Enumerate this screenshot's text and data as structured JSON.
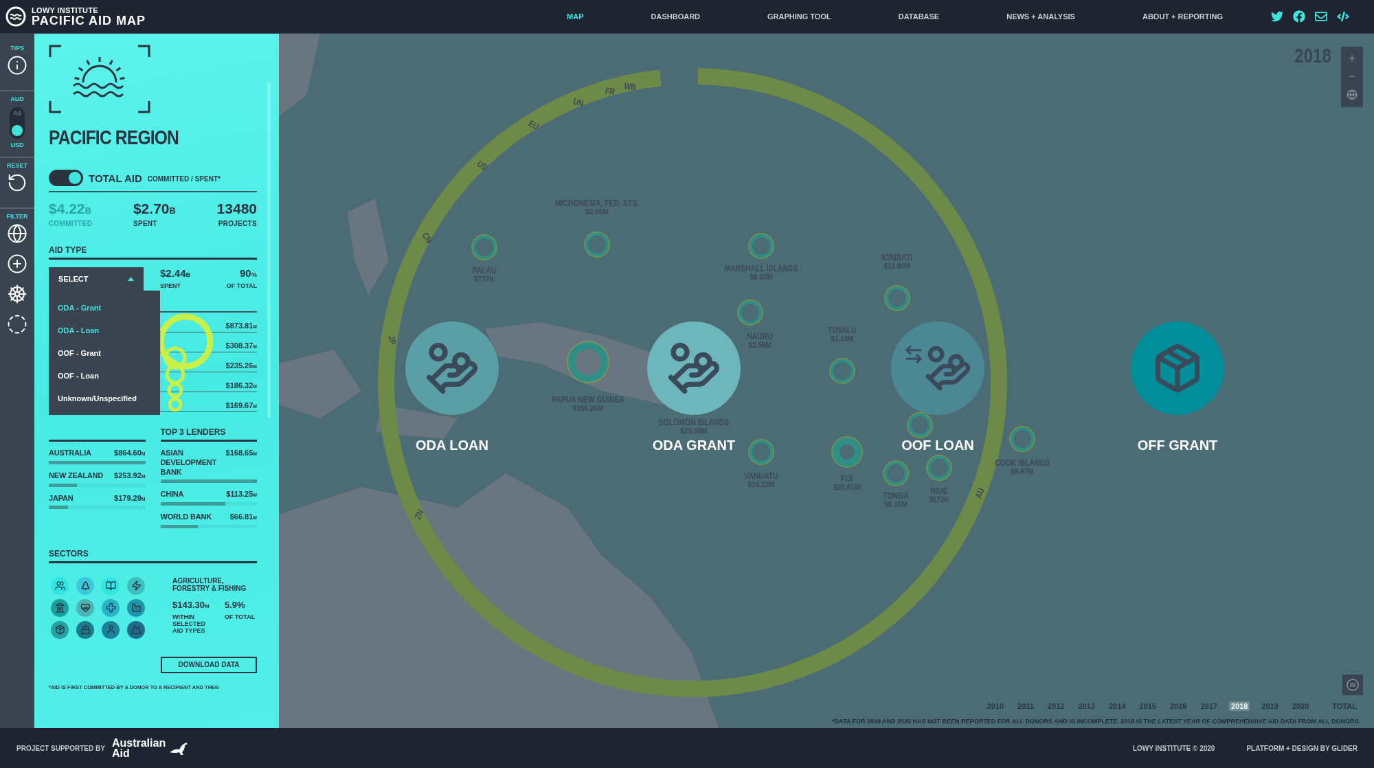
{
  "header": {
    "logo_small": "LOWY INSTITUTE",
    "logo_title": "PACIFIC AID MAP",
    "nav": [
      {
        "label": "MAP",
        "selected": true
      },
      {
        "label": "DASHBOARD",
        "selected": false
      },
      {
        "label": "GRAPHING TOOL",
        "selected": false
      },
      {
        "label": "DATABASE",
        "selected": false
      },
      {
        "label": "NEWS + ANALYSIS",
        "selected": false
      },
      {
        "label": "ABOUT + REPORTING",
        "selected": false
      }
    ]
  },
  "rail": {
    "tips_label": "TIPS",
    "currency": {
      "symbol": "A$",
      "options": [
        {
          "label": "AUD",
          "selected": false
        },
        {
          "label": "USD",
          "selected": true
        }
      ]
    },
    "reset_label": "RESET",
    "filter_label": "FILTER"
  },
  "panel": {
    "region_title": "PACIFIC REGION",
    "total_aid": {
      "on": true,
      "label": "TOTAL AID",
      "sublabel": "COMMITTED / SPENT*"
    },
    "stats": [
      {
        "value": "$4.22",
        "unit": "B",
        "label": "COMMITTED",
        "dimmed": true
      },
      {
        "value": "$2.70",
        "unit": "B",
        "label": "SPENT",
        "dimmed": false
      },
      {
        "value": "13480",
        "label": "PROJECTS",
        "dimmed": false
      }
    ],
    "aid_type": {
      "heading": "AID TYPE",
      "select_label": "SELECT",
      "expanded": true,
      "options": [
        {
          "label": "ODA - Grant",
          "selected": true
        },
        {
          "label": "ODA - Loan",
          "selected": true
        },
        {
          "label": "OOF - Grant",
          "selected": false
        },
        {
          "label": "OOF - Loan",
          "selected": false
        },
        {
          "label": "Unknown/Unspecified",
          "selected": false
        }
      ],
      "spent": {
        "value": "$2.44",
        "unit": "B",
        "label": "SPENT"
      },
      "share": {
        "value": "90",
        "unit": "%",
        "label": "OF TOTAL"
      },
      "recipient_values": [
        {
          "value": "$873.81",
          "unit": "M"
        },
        {
          "value": "$308.37",
          "unit": "M"
        },
        {
          "value": "$235.26",
          "unit": "M"
        },
        {
          "value": "$186.32",
          "unit": "M"
        },
        {
          "value": "$169.67",
          "unit": "M"
        }
      ]
    },
    "grantors": {
      "rows": [
        {
          "name": "AUSTRALIA",
          "value": "$864.60",
          "unit": "M",
          "level": 1
        },
        {
          "name": "NEW ZEALAND",
          "value": "$253.92",
          "unit": "M",
          "level": 0.29
        },
        {
          "name": "JAPAN",
          "value": "$179.29",
          "unit": "M",
          "level": 0.2
        }
      ]
    },
    "lenders": {
      "heading": "TOP 3 LENDERS",
      "rows": [
        {
          "name": "ASIAN DEVELOPMENT BANK",
          "value": "$168.65",
          "unit": "M",
          "level": 1
        },
        {
          "name": "CHINA",
          "value": "$113.25",
          "unit": "M",
          "level": 0.67
        },
        {
          "name": "WORLD BANK",
          "value": "$66.81",
          "unit": "M",
          "level": 0.39
        }
      ]
    },
    "sectors": {
      "heading": "SECTORS",
      "items": [
        {
          "color": "#2fe6e2"
        },
        {
          "color": "#3cc9dc"
        },
        {
          "color": "#2fe6e2"
        },
        {
          "color": "#3bbfbf"
        },
        {
          "color": "#1c9f9f"
        },
        {
          "color": "#4db4b4"
        },
        {
          "color": "#28b3c8"
        },
        {
          "color": "#1d97ac"
        },
        {
          "color": "#27a2a2"
        },
        {
          "color": "#1a7d8d"
        },
        {
          "color": "#1b8399"
        },
        {
          "color": "#1f6b8c"
        }
      ],
      "detail_title": "AGRICULTURE, FORESTRY & FISHING",
      "detail_value": "$143.30",
      "detail_unit": "M",
      "detail_share": "5.9%",
      "detail_value_label": "WITHIN SELECTED AID TYPES",
      "detail_share_label": "OF TOTAL"
    },
    "download_label": "DOWNLOAD DATA",
    "footnote": "*AID IS FIRST COMMITTED BY A DONOR TO A RECIPIENT AND THEN"
  },
  "map": {
    "year": "2018",
    "donors": [
      "WB",
      "FR",
      "UN",
      "EU",
      "US",
      "CN",
      "JP",
      "NZ",
      "AU"
    ],
    "countries": [
      {
        "name": "MICRONESIA, FED. STS.",
        "amount": "$2.85M"
      },
      {
        "name": "PALAU",
        "amount": "$777K"
      },
      {
        "name": "MARSHALL ISLANDS",
        "amount": "$8.07M"
      },
      {
        "name": "NAURU",
        "amount": "$2.58M"
      },
      {
        "name": "KIRIBATI",
        "amount": "$11.80M"
      },
      {
        "name": "TUVALU",
        "amount": "$1.63M"
      },
      {
        "name": "PAPUA NEW GUINEA",
        "amount": "$156.26M"
      },
      {
        "name": "SOLOMON ISLANDS",
        "amount": "$29.99M"
      },
      {
        "name": "VANUATU",
        "amount": "$18.22M"
      },
      {
        "name": "FIJI",
        "amount": "$25.61M"
      },
      {
        "name": "TONGA",
        "amount": "$8.15M"
      },
      {
        "name": "NIUE",
        "amount": "$572K"
      },
      {
        "name": "COOK ISLANDS",
        "amount": "$8.87M"
      }
    ],
    "aid_types": [
      {
        "label": "ODA LOAN",
        "color": "#5a9fa5"
      },
      {
        "label": "ODA GRANT",
        "color": "#6db6bc"
      },
      {
        "label": "OOF LOAN",
        "color": "#4b8893"
      },
      {
        "label": "OFF GRANT",
        "color": "#028d9a"
      }
    ],
    "timeline": [
      {
        "label": "2010",
        "selected": false
      },
      {
        "label": "2011",
        "selected": false
      },
      {
        "label": "2012",
        "selected": false
      },
      {
        "label": "2013",
        "selected": false
      },
      {
        "label": "2014",
        "selected": false
      },
      {
        "label": "2015",
        "selected": false
      },
      {
        "label": "2016",
        "selected": false
      },
      {
        "label": "2017",
        "selected": false
      },
      {
        "label": "2018",
        "selected": true
      },
      {
        "label": "2019",
        "selected": false
      },
      {
        "label": "2020",
        "selected": false
      },
      {
        "label": "TOTAL",
        "selected": false
      }
    ],
    "note": "*DATA FOR 2019 AND 2020 HAS NOT BEEN REPORTED FOR ALL DONORS AND IS INCOMPLETE. 2018 IS THE LATEST YEAR OF COMPREHENSIVE AID DATA FROM ALL DONORS."
  },
  "footer": {
    "supported_label": "PROJECT SUPPORTED BY",
    "aid_logo": "Australian Aid",
    "copyright": "LOWY INSTITUTE © 2020",
    "credit": "PLATFORM + DESIGN BY GLIDER"
  }
}
